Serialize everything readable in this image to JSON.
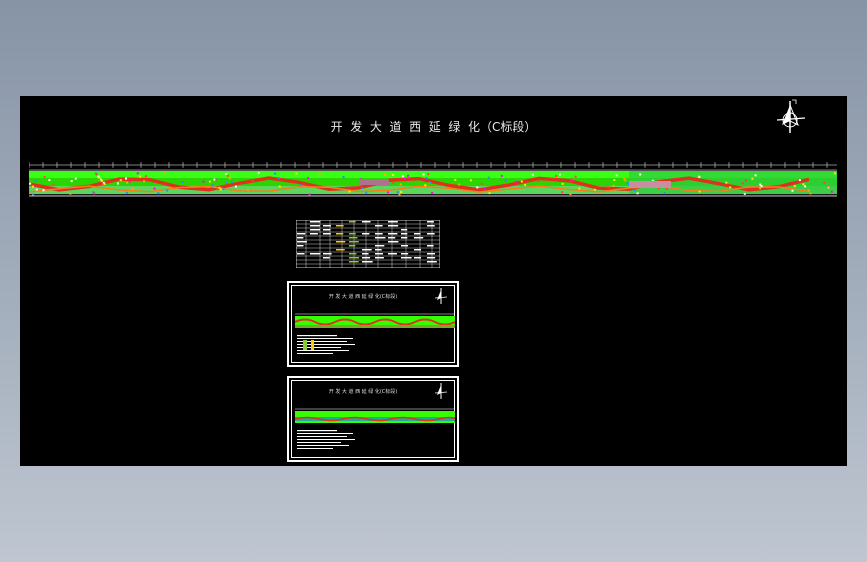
{
  "drawing": {
    "title": "开  发  大  道  西  延  绿  化（C标段）",
    "sheet_title": "开 发 大 道 西 延 绿 化(C标段)"
  },
  "colors": {
    "background_top": "#8794a6",
    "background_bottom": "#bfc6d1",
    "canvas": "#000000",
    "plant_green": "#33ff00",
    "plant_red": "#e0301e",
    "plant_yellow": "#ffee00",
    "line_white": "#ffffff"
  },
  "icons": {
    "north_arrow": "north-arrow-icon"
  }
}
